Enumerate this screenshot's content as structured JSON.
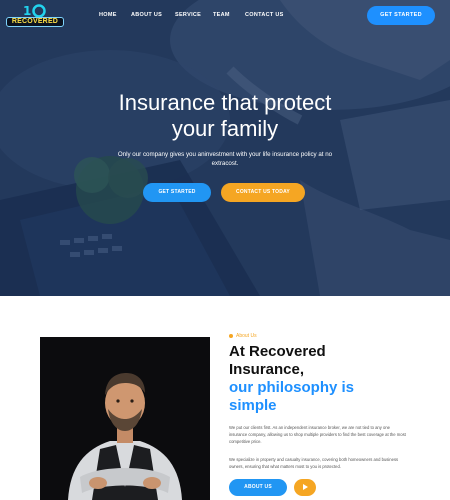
{
  "brand": {
    "logo_text": "RECOVERED",
    "logo_colors": {
      "ring": "#22d3ee",
      "text": "#fde047"
    }
  },
  "nav": {
    "items": [
      "HOME",
      "ABOUT US",
      "SERVICE",
      "TEAM",
      "CONTACT US"
    ],
    "cta_label": "GET STARTED"
  },
  "hero": {
    "title_line1": "Insurance that protect",
    "title_line2": "your family",
    "subtitle": "Only our company gives you aninvestment with your life insurance policy at no extracost.",
    "primary_button": "GET STARTED",
    "secondary_button": "CONTACT US TODAY"
  },
  "about": {
    "tag": "About Us",
    "title_line1": "At Recovered",
    "title_line2": "Insurance,",
    "title_highlight_line1": "our philosophy is",
    "title_highlight_line2": "simple",
    "paragraph1": "We put our clients first. As an independent insurance broker, we are not tied to any one insurance company, allowing us to shop multiple providers to find the best coverage at the most competitive price.",
    "paragraph2": "We specialize in property and casualty insurance, covering both homeowners and business owners, ensuring that what matters most to you is protected.",
    "button": "ABOUT US",
    "play_icon": "play-icon"
  },
  "colors": {
    "primary": "#2196f3",
    "accent": "#f5a623",
    "hero_overlay": "#243a5c",
    "highlight_text": "#1e90ff"
  }
}
